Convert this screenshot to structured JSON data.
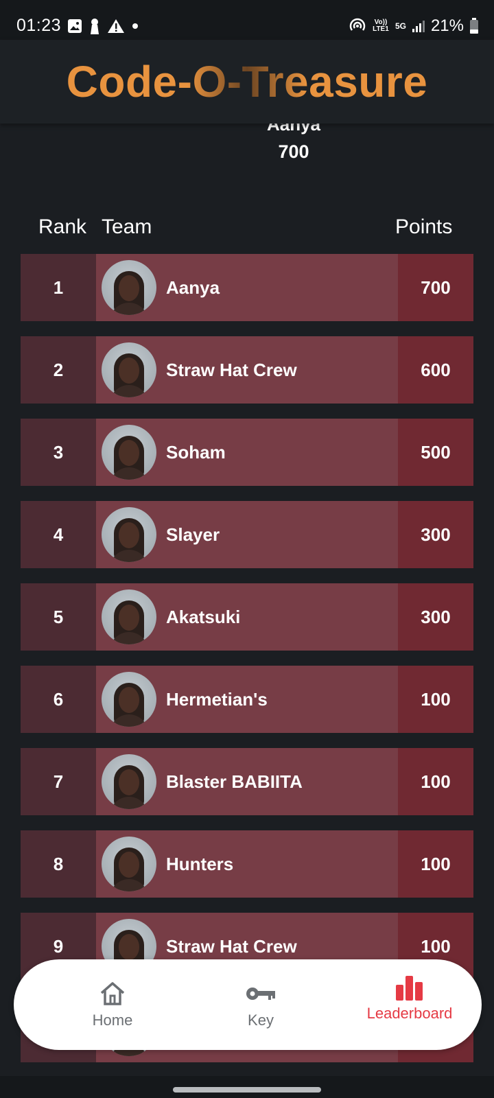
{
  "status": {
    "time": "01:23",
    "battery": "21%",
    "network_volte": "Vo)) LTE1",
    "network_5g": "5G"
  },
  "header": {
    "title": "Code-O-Treasure"
  },
  "podium": {
    "name": "Aanya",
    "points": "700"
  },
  "columns": {
    "rank": "Rank",
    "team": "Team",
    "points": "Points"
  },
  "rows": [
    {
      "rank": "1",
      "team": "Aanya",
      "points": "700"
    },
    {
      "rank": "2",
      "team": "Straw Hat Crew",
      "points": "600"
    },
    {
      "rank": "3",
      "team": "Soham",
      "points": "500"
    },
    {
      "rank": "4",
      "team": "Slayer",
      "points": "300"
    },
    {
      "rank": "5",
      "team": "Akatsuki",
      "points": "300"
    },
    {
      "rank": "6",
      "team": "Hermetian's",
      "points": "100"
    },
    {
      "rank": "7",
      "team": "Blaster BABIITA",
      "points": "100"
    },
    {
      "rank": "8",
      "team": "Hunters",
      "points": "100"
    },
    {
      "rank": "9",
      "team": "Straw Hat Crew",
      "points": "100"
    },
    {
      "rank": "",
      "team": "",
      "points": ""
    }
  ],
  "nav": {
    "items": [
      {
        "label": "Home",
        "icon": "home-icon",
        "active": false
      },
      {
        "label": "Key",
        "icon": "key-icon",
        "active": false
      },
      {
        "label": "Leaderboard",
        "icon": "leaderboard-icon",
        "active": true
      }
    ],
    "active_color": "#e53a44"
  },
  "colors": {
    "background": "#1b1e22",
    "title": "#e8933f",
    "rank_cell": "#4c2b33",
    "team_cell": "#773d46",
    "points_cell": "#702932"
  }
}
